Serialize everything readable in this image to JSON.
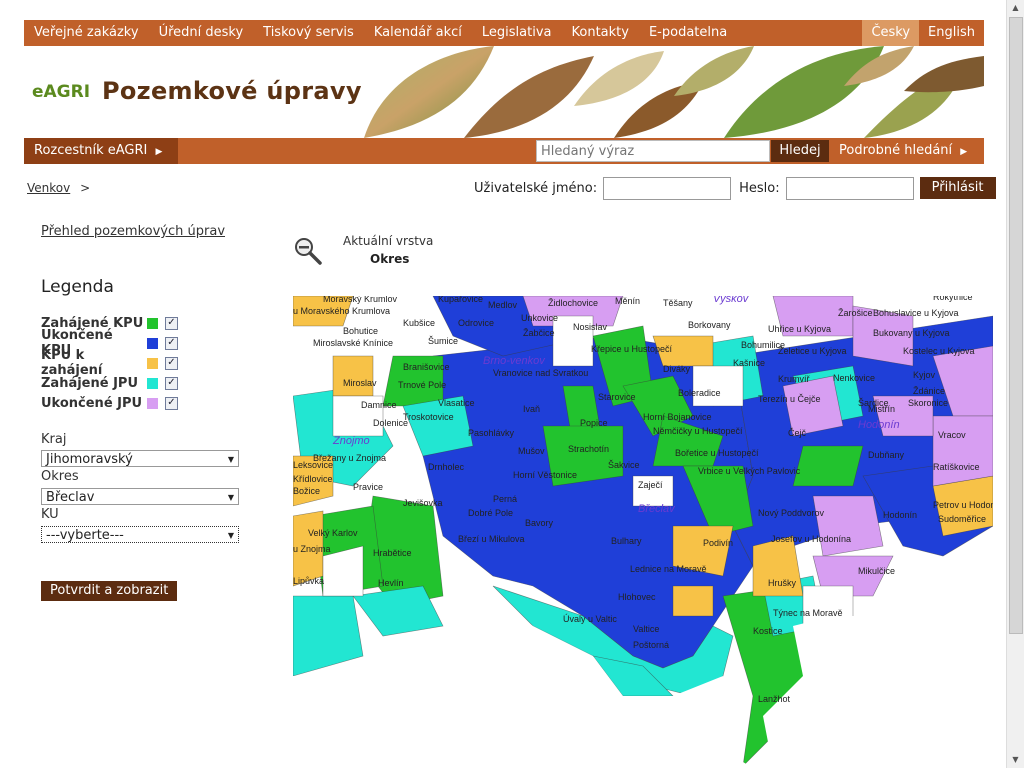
{
  "topnav": {
    "items": [
      "Veřejné zakázky",
      "Úřední desky",
      "Tiskový servis",
      "Kalendář akcí",
      "Legislativa",
      "Kontakty",
      "E-podatelna"
    ],
    "lang_active": "Česky",
    "lang_other": "English"
  },
  "header": {
    "logo": "eAGRI",
    "title": "Pozemkové úpravy"
  },
  "bar2": {
    "left_link": "Rozcestník eAGRI",
    "search_placeholder": "Hledaný výraz",
    "search_button": "Hledej",
    "advanced": "Podrobné hledání"
  },
  "breadcrumb": {
    "link": "Venkov",
    "sep": ">"
  },
  "login": {
    "user_label": "Uživatelské jméno:",
    "pw_label": "Heslo:",
    "button": "Přihlásit"
  },
  "sidebar": {
    "overview_link": "Přehled pozemkových úprav",
    "legend_title": "Legenda",
    "legend": [
      {
        "label": "Zahájené KPU",
        "color": "#22c32e"
      },
      {
        "label": "Ukončené KPU",
        "color": "#1f3fd8"
      },
      {
        "label": "KPU k zahájení",
        "color": "#f7c247"
      },
      {
        "label": "Zahájené JPU",
        "color": "#22e6d2"
      },
      {
        "label": "Ukončené JPU",
        "color": "#d79ef2"
      }
    ],
    "kraj_label": "Kraj",
    "kraj_value": "Jihomoravský",
    "okres_label": "Okres",
    "okres_value": "Břeclav",
    "ku_label": "KU",
    "ku_value": "---vyberte---",
    "confirm": "Potvrdit a zobrazit"
  },
  "layer": {
    "label": "Aktuální vrstva",
    "value": "Okres"
  },
  "map": {
    "cities": [
      "Brno-venkov",
      "Vyškov",
      "Znojmo",
      "Hodonín",
      "Břeclav"
    ],
    "places": [
      "Moravský Krumlov",
      "Kupařovice",
      "Medlov",
      "Židlochovice",
      "Měnín",
      "Těšany",
      "Rokytnice",
      "u Moravského Krumlova",
      "Kubšice",
      "Odrovice",
      "Unkovice",
      "Žabčice",
      "Nosislav",
      "Borkovany",
      "Uhřice u Kyjova",
      "Žarošice",
      "Bohuslavice u Kyjova",
      "Bohutice",
      "Miroslavské Knínice",
      "Šumice",
      "Křepice u Hustopečí",
      "Bohumilice",
      "Želetice u Kyjova",
      "Bukovany u Kyjova",
      "Kostelec u Kyjova",
      "Branišovice",
      "Vranovice nad Svratkou",
      "Diváky",
      "Kašnice",
      "Krumvíř",
      "Nenkovice",
      "Kyjov",
      "Ždánice",
      "Miroslav",
      "Trnové Pole",
      "Starovice",
      "Boleradice",
      "Terezín u Čejče",
      "Šardice",
      "Skoronice",
      "Damnice",
      "Vlasatice",
      "Ivaň",
      "Horní Bojanovice",
      "Mistřín",
      "Troskotovice",
      "Popice",
      "Němčičky u Hustopečí",
      "Čejč",
      "Dolenice",
      "Pasohlávky",
      "Strachotín",
      "Bořetice u Hustopečí",
      "Dubňany",
      "Vracov",
      "Břežany u Znojma",
      "Mušov",
      "Šakvice",
      "Vrbice u Velkých Pavlovic",
      "Ratíškovice",
      "Drnholec",
      "Horní Věstonice",
      "Zaječí",
      "Křídlovice",
      "Pravice",
      "Perná",
      "Božice",
      "Jevišovka",
      "Dobré Pole",
      "Nový Poddvorov",
      "Hodonín",
      "Petrov u Hodonína",
      "Sudoměřice",
      "Bavory",
      "Josefov u Hodonína",
      "Velký Karlov",
      "Březí u Mikulova",
      "Bulhary",
      "Podivín",
      "Hrabětice",
      "u Znojma",
      "Lednice na Moravě",
      "Mikulčice",
      "Hevlín",
      "Hrušky",
      "Hlohovec",
      "Týnec na Moravě",
      "Úvaly u Valtic",
      "Valtice",
      "Kostice",
      "Poštorná",
      "Lanžhot",
      "Lipůvka",
      "Leksovice"
    ]
  }
}
